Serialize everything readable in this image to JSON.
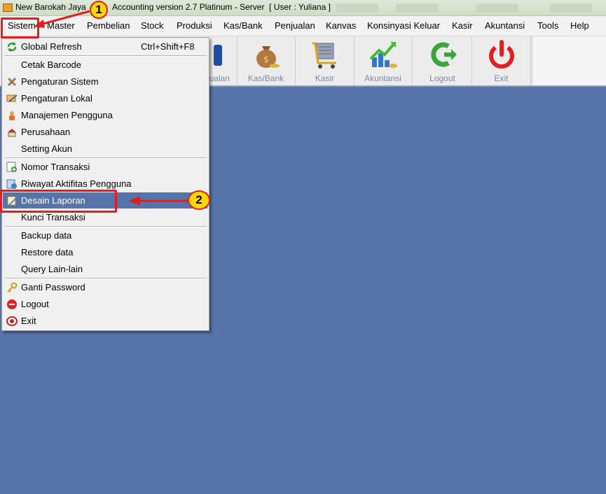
{
  "window": {
    "title_left": "New Barokah Jaya",
    "title_right": "Accounting version 2.7 Platinum - Server  [ User : Yuliana ]"
  },
  "menubar": [
    "Sistem",
    "Master",
    "Pembelian",
    "Stock",
    "Produksi",
    "Kas/Bank",
    "Penjualan",
    "Kanvas",
    "Konsinyasi Keluar",
    "Kasir",
    "Akuntansi",
    "Tools",
    "Help"
  ],
  "toolbar": [
    "Penjualan",
    "Kas/Bank",
    "Kasir",
    "Akuntansi",
    "Logout",
    "Exit"
  ],
  "toolbar_partial": "ualan",
  "dropdown": {
    "items": [
      {
        "label": "Global Refresh",
        "shortcut": "Ctrl+Shift+F8",
        "icon": "refresh-icon"
      },
      {
        "label": "Cetak Barcode",
        "icon": ""
      },
      {
        "label": "Pengaturan Sistem",
        "icon": "tools-icon"
      },
      {
        "label": "Pengaturan Lokal",
        "icon": "local-settings-icon"
      },
      {
        "label": "Manajemen Pengguna",
        "icon": "user-icon"
      },
      {
        "label": "Perusahaan",
        "icon": "company-icon"
      },
      {
        "label": "Setting Akun",
        "icon": ""
      },
      {
        "label": "Nomor Transaksi",
        "icon": "add-number-icon"
      },
      {
        "label": "Riwayat Aktifitas Pengguna",
        "icon": "history-icon"
      },
      {
        "label": "Desain Laporan",
        "icon": "report-design-icon"
      },
      {
        "label": "Kunci Transaksi",
        "icon": ""
      },
      {
        "label": "Backup data",
        "icon": ""
      },
      {
        "label": "Restore data",
        "icon": ""
      },
      {
        "label": "Query Lain-lain",
        "icon": ""
      },
      {
        "label": "Ganti Password",
        "icon": "key-icon"
      },
      {
        "label": "Logout",
        "icon": "logout-icon"
      },
      {
        "label": "Exit",
        "icon": "exit-icon"
      }
    ]
  },
  "annotations": {
    "step1": "1",
    "step2": "2"
  },
  "colors": {
    "workspace": "#5673aa",
    "highlight": "#e01e1e",
    "badge": "#ffd800"
  }
}
